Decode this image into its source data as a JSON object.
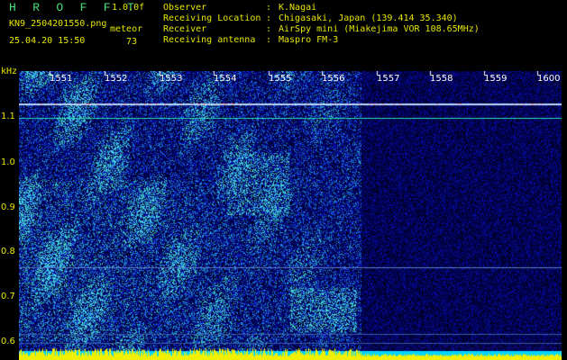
{
  "header": {
    "title": "H R O F F T",
    "version": "1.0.0f",
    "filename": "KN9_2504201550.png",
    "datetime": "25.04.20 15:50",
    "meteor_label": "meteor",
    "meteor_count": "73"
  },
  "info": [
    {
      "key": "Observer",
      "value": "K.Nagai"
    },
    {
      "key": "Receiving Location",
      "value": "Chigasaki, Japan (139.414 35.340)"
    },
    {
      "key": "Receiver",
      "value": "AirSpy mini (Miakejima VOR 108.65MHz)"
    },
    {
      "key": "Receiving antenna",
      "value": "Maspro FM-3"
    }
  ],
  "axis": {
    "y_unit": "kHz",
    "y_ticks": [
      "1.1",
      "1.0",
      "0.9",
      "0.8",
      "0.7",
      "0.6"
    ],
    "x_ticks": [
      "1551",
      "1552",
      "1553",
      "1554",
      "1555",
      "1556",
      "1557",
      "1558",
      "1559",
      "1600"
    ]
  },
  "colors": {
    "background": "#000000",
    "label": "#e6e600",
    "title": "#46e07a",
    "noise_low": "#000a6e",
    "noise_high": "#22d6e0"
  }
}
